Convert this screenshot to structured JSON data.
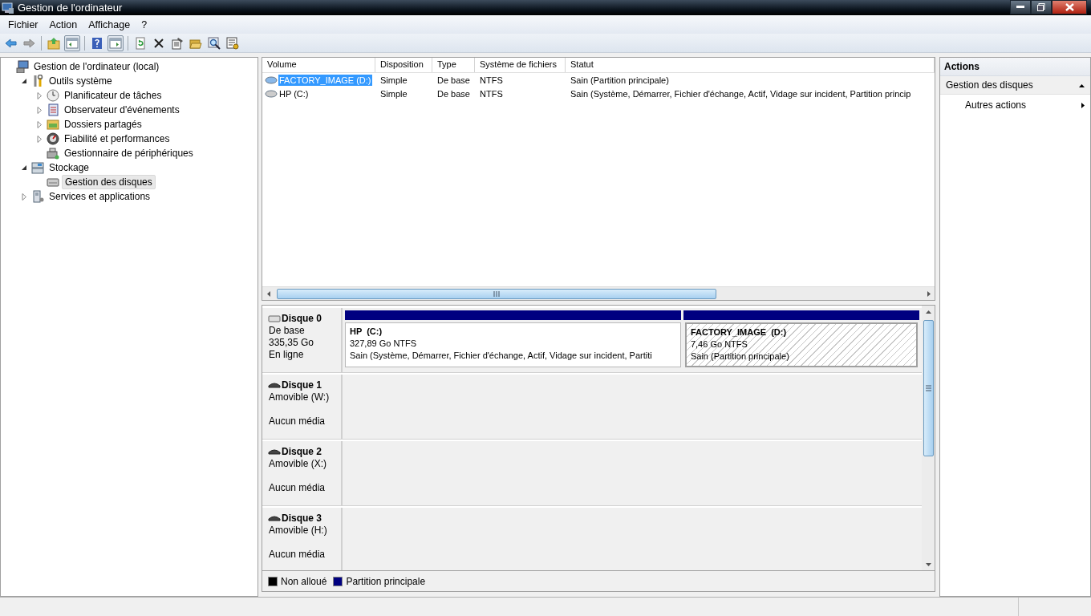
{
  "window": {
    "title": "Gestion de l'ordinateur"
  },
  "menu": [
    {
      "label": "Fichier"
    },
    {
      "label": "Action"
    },
    {
      "label": "Affichage"
    },
    {
      "label": "?"
    }
  ],
  "toolbar": [
    {
      "kind": "back",
      "pressed": false
    },
    {
      "kind": "forward",
      "pressed": false
    },
    {
      "kind": "separator"
    },
    {
      "kind": "up",
      "pressed": false
    },
    {
      "kind": "tree",
      "pressed": true
    },
    {
      "kind": "separator"
    },
    {
      "kind": "help",
      "pressed": false
    },
    {
      "kind": "pane",
      "pressed": true
    },
    {
      "kind": "separator"
    },
    {
      "kind": "refresh",
      "pressed": false
    },
    {
      "kind": "delete",
      "pressed": false
    },
    {
      "kind": "properties",
      "pressed": false
    },
    {
      "kind": "open",
      "pressed": false
    },
    {
      "kind": "search",
      "pressed": false
    },
    {
      "kind": "settings",
      "pressed": false
    }
  ],
  "tree": [
    {
      "label": "Gestion de l'ordinateur (local)",
      "kind": "computer",
      "selected": false,
      "children": [
        {
          "label": "Outils système",
          "kind": "tools",
          "expanded": true,
          "selected": false,
          "children": [
            {
              "label": "Planificateur de tâches",
              "kind": "clock",
              "expanded": false,
              "selected": false
            },
            {
              "label": "Observateur d'événements",
              "kind": "log",
              "expanded": false,
              "selected": false
            },
            {
              "label": "Dossiers partagés",
              "kind": "share",
              "expanded": false,
              "selected": false
            },
            {
              "label": "Fiabilité et performances",
              "kind": "gauge",
              "expanded": false,
              "selected": false
            },
            {
              "label": "Gestionnaire de périphériques",
              "kind": "device",
              "selected": false
            }
          ]
        },
        {
          "label": "Stockage",
          "kind": "storage",
          "expanded": true,
          "selected": false,
          "children": [
            {
              "label": "Gestion des disques",
              "kind": "disk",
              "selected": true
            }
          ]
        },
        {
          "label": "Services et applications",
          "kind": "services",
          "expanded": false,
          "selected": false
        }
      ]
    }
  ],
  "volumes": {
    "columns": [
      "Volume",
      "Disposition",
      "Type",
      "Système de fichiers",
      "Statut"
    ],
    "rows": [
      {
        "selected": true,
        "cells": [
          "FACTORY_IMAGE (D:)",
          "Simple",
          "De base",
          "NTFS",
          "Sain (Partition principale)"
        ]
      },
      {
        "selected": false,
        "cells": [
          "HP (C:)",
          "Simple",
          "De base",
          "NTFS",
          "Sain (Système, Démarrer, Fichier d'échange, Actif, Vidage sur incident, Partition princip"
        ]
      }
    ]
  },
  "disks": [
    {
      "name": "Disque 0",
      "kind": "fixed",
      "type": "De base",
      "size": "335,35 Go",
      "status": "En ligne",
      "partitions": [
        {
          "label": "HP  (C:)",
          "size": "327,89 Go NTFS",
          "status": "Sain (Système, Démarrer, Fichier d'échange, Actif, Vidage sur incident, Partiti",
          "kind": "primary",
          "selected": false
        },
        {
          "label": "FACTORY_IMAGE  (D:)",
          "size": "7,46 Go NTFS",
          "status": "Sain (Partition principale)",
          "kind": "primary",
          "selected": true
        }
      ]
    },
    {
      "name": "Disque 1",
      "kind": "removable",
      "type": "Amovible (W:)",
      "status": "Aucun média"
    },
    {
      "name": "Disque 2",
      "kind": "removable",
      "type": "Amovible (X:)",
      "status": "Aucun média"
    },
    {
      "name": "Disque 3",
      "kind": "removable",
      "type": "Amovible (H:)",
      "status": "Aucun média"
    }
  ],
  "legend": [
    {
      "label": "Non alloué",
      "color": "#000000"
    },
    {
      "label": "Partition principale",
      "color": "#000080"
    }
  ],
  "actions": {
    "title": "Actions",
    "sections": [
      {
        "label": "Gestion des disques",
        "expanded": true,
        "items": [
          {
            "label": "Autres actions",
            "submenu": true
          }
        ]
      }
    ]
  }
}
